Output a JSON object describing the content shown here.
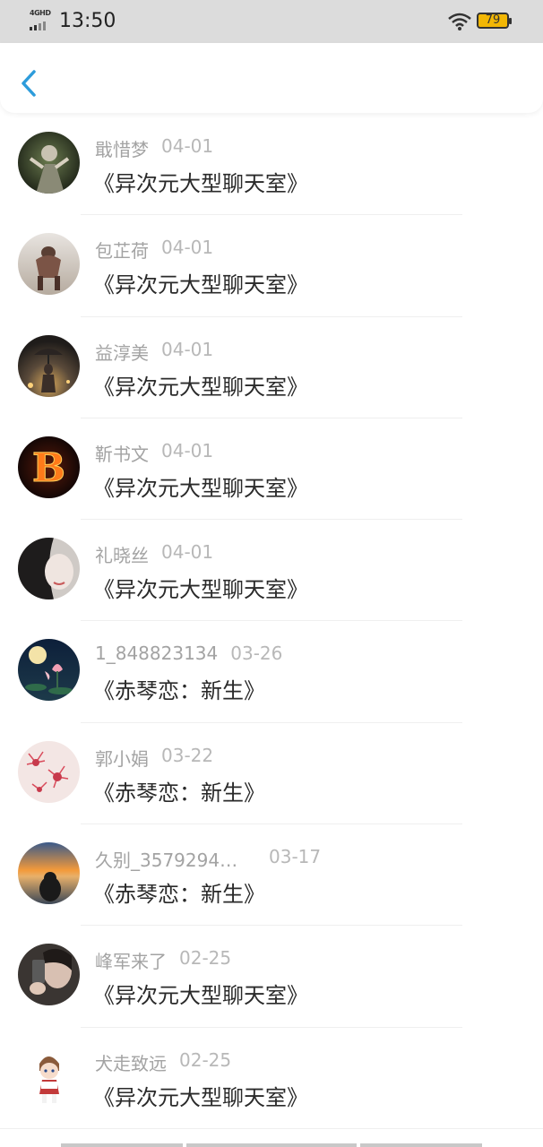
{
  "status_bar": {
    "network": "4G",
    "network_sub": "HD",
    "time": "13:50",
    "battery": "79"
  },
  "header": {
    "back_icon": "chevron-left-icon",
    "accent": "#2d9cdb"
  },
  "items": [
    {
      "name": "戢惜梦",
      "date": "04-01",
      "title": "《异次元大型聊天室》",
      "avatar": "dark-figure"
    },
    {
      "name": "包芷荷",
      "date": "04-01",
      "title": "《异次元大型聊天室》",
      "avatar": "desert-figure"
    },
    {
      "name": "益淳美",
      "date": "04-01",
      "title": "《异次元大型聊天室》",
      "avatar": "night-umbrella"
    },
    {
      "name": "靳书文",
      "date": "04-01",
      "title": "《异次元大型聊天室》",
      "avatar": "fire-letter"
    },
    {
      "name": "礼晓丝",
      "date": "04-01",
      "title": "《异次元大型聊天室》",
      "avatar": "pale-face"
    },
    {
      "name": "1_848823134",
      "date": "03-26",
      "title": "《赤琴恋：新生》",
      "avatar": "lotus-moon"
    },
    {
      "name": "郭小娟",
      "date": "03-22",
      "title": "《赤琴恋：新生》",
      "avatar": "red-flowers"
    },
    {
      "name": "久别_3579294…",
      "date": "03-17",
      "title": "《赤琴恋：新生》",
      "avatar": "sunset-sea"
    },
    {
      "name": "峰军来了",
      "date": "02-25",
      "title": "《异次元大型聊天室》",
      "avatar": "selfie"
    },
    {
      "name": "犬走致远",
      "date": "02-25",
      "title": "《异次元大型聊天室》",
      "avatar": "anime-boy"
    }
  ],
  "avatar_letter": "B"
}
